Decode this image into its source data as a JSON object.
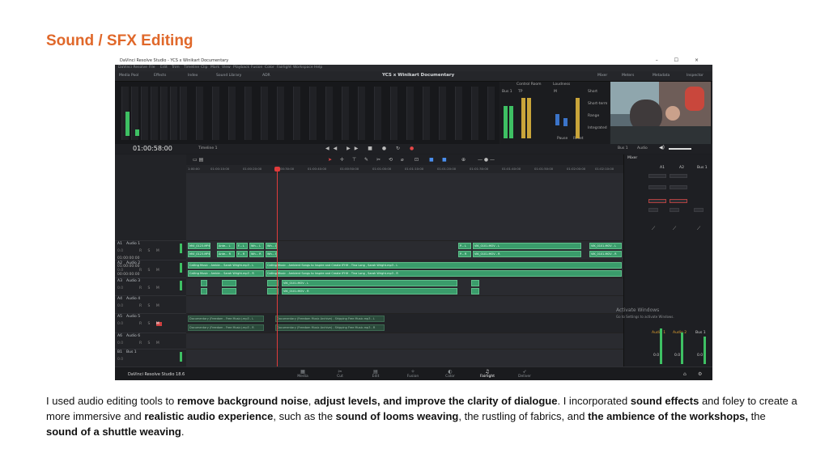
{
  "heading": "Sound / SFX Editing",
  "screenshot": {
    "window_title": "DaVinci Resolve Studio - YCS x Winikart Documentary",
    "window_controls": "–  ☐  ×",
    "menu": [
      "DaVinci Resolve",
      "File",
      "Edit",
      "Trim",
      "Timeline",
      "Clip",
      "Mark",
      "View",
      "Playback",
      "Fusion",
      "Color",
      "Fairlight",
      "Workspace",
      "Help"
    ],
    "toolbar_left": [
      "Media Pool",
      "Effects",
      "Index",
      "Sound Library",
      "ADR"
    ],
    "project_title": "YCS x Winikart Documentary",
    "toolbar_right": [
      "Mixer",
      "Meters",
      "Metadata",
      "Inspector"
    ],
    "control_room": {
      "title": "Control Room",
      "loudness": "Loudness",
      "tp": "TP",
      "bus": "Bus 1",
      "m": "M",
      "short": "Short",
      "short_term": "Short-term",
      "range": "Range",
      "integrated": "Integrated",
      "pause": "Pause",
      "reset": "Reset"
    },
    "timecode": "01:00:58:00",
    "timeline_name": "Timeline 1",
    "transport": "◀◀ ▶▶ ■ ● ↻",
    "viewer_bus": "Bus 1",
    "viewer_audio": "Audio",
    "track_timecodes": [
      "01:00:00:00",
      "01:00:00:00",
      "00:00:00:00"
    ],
    "tracks": [
      {
        "code": "A1",
        "name": "Audio 1",
        "sub": "0.0"
      },
      {
        "code": "A2",
        "name": "Audio 2",
        "sub": "0.0"
      },
      {
        "code": "A3",
        "name": "Audio 3",
        "sub": "0.0"
      },
      {
        "code": "A4",
        "name": "Audio 4",
        "sub": "0.0"
      },
      {
        "code": "A5",
        "name": "Audio 5",
        "sub": "0.0"
      },
      {
        "code": "A6",
        "name": "Audio 6",
        "sub": "0.0"
      },
      {
        "code": "B1",
        "name": "Bus 1",
        "sub": "0.0"
      }
    ],
    "ruler_ticks": [
      "1:00:00",
      "01:00:10:00",
      "01:00:20:00",
      "01:00:30:00",
      "01:00:40:00",
      "01:00:50:00",
      "01:01:00:00",
      "01:01:10:00",
      "01:01:20:00",
      "01:01:30:00",
      "01:01:40:00",
      "01:01:50:00",
      "01:02:00:00",
      "01:02:10:00"
    ],
    "clips": {
      "a1_lane1": [
        "MVI_0123.MP4",
        "Ante... L",
        "F... L",
        "Wh... L",
        "Wh... L",
        "P... L",
        "VIK_0101.MOV - L",
        "VIK_0101.MOV - L"
      ],
      "a1_lane2": [
        "MVI_0123.MP4",
        "Ante... R",
        "F... R",
        "Wh... R",
        "Wh... R",
        "P... R",
        "VIK_0101.MOV - R",
        "VIK_0101.MOV - R"
      ],
      "a2_lane1": [
        "Calling Music - Ambie... Sarah Wright.mp3 - L",
        "Calling Music - Ambient Songs to Inspire and Create IFHH - Tina Long , Sarah Wright.mp3 - L"
      ],
      "a2_lane2": [
        "Calling Music - Ambie... Sarah Wright.mp3 - R",
        "Calling Music - Ambient Songs to Inspire and Create IFHH - Tina Long , Sarah Wright.mp3 - R"
      ],
      "a3_lane1": [
        "VIK_0101.MOV - L",
        "VIK_0101.MOV - L"
      ],
      "a3_lane2": [
        "VIK_0101.MOV - R",
        "VIK_0101.MOV - R"
      ],
      "a5_lane1": [
        "Documentary (Freedom - Free Music).mp3 - L",
        "Documentary (Freedom Music Archive) - Shipping Free Music.mp3 - L"
      ],
      "a5_lane2": [
        "Documentary (Freedom - Free Music).mp3 - R",
        "Documentary (Freedom Music Archive) - Shipping Free Music.mp3 - R"
      ]
    },
    "mixer": {
      "title": "Mixer",
      "channels": [
        "A1",
        "A2",
        "Bus 1"
      ],
      "strip_names": [
        "Audio 1",
        "Audio 2",
        "Bus 1"
      ],
      "values": [
        "0.0",
        "0.0",
        "0.0"
      ]
    },
    "watermark_1": "Activate Windows",
    "watermark_2": "Go to Settings to activate Windows.",
    "brand": "DaVinci Resolve Studio 18.6",
    "pages": [
      "Media",
      "Cut",
      "Edit",
      "Fusion",
      "Color",
      "Fairlight",
      "Deliver"
    ],
    "active_page": "Fairlight"
  },
  "paragraph": {
    "p1": "I used audio editing tools to ",
    "b1": "remove background noise",
    "p2": ", ",
    "b2": "adjust levels, and improve the clarity of dialogue",
    "p3": ". I incorporated ",
    "b3": "sound effects",
    "p4": " and foley to create a more immersive and ",
    "b4": "realistic audio experience",
    "p5": ", such as the ",
    "b5": "sound of looms weaving",
    "p6": ", the rustling of fabrics, and ",
    "b6": "the ambience of the workshops,",
    "p7": " the ",
    "b7": "sound of a shuttle weaving",
    "p8": "."
  }
}
